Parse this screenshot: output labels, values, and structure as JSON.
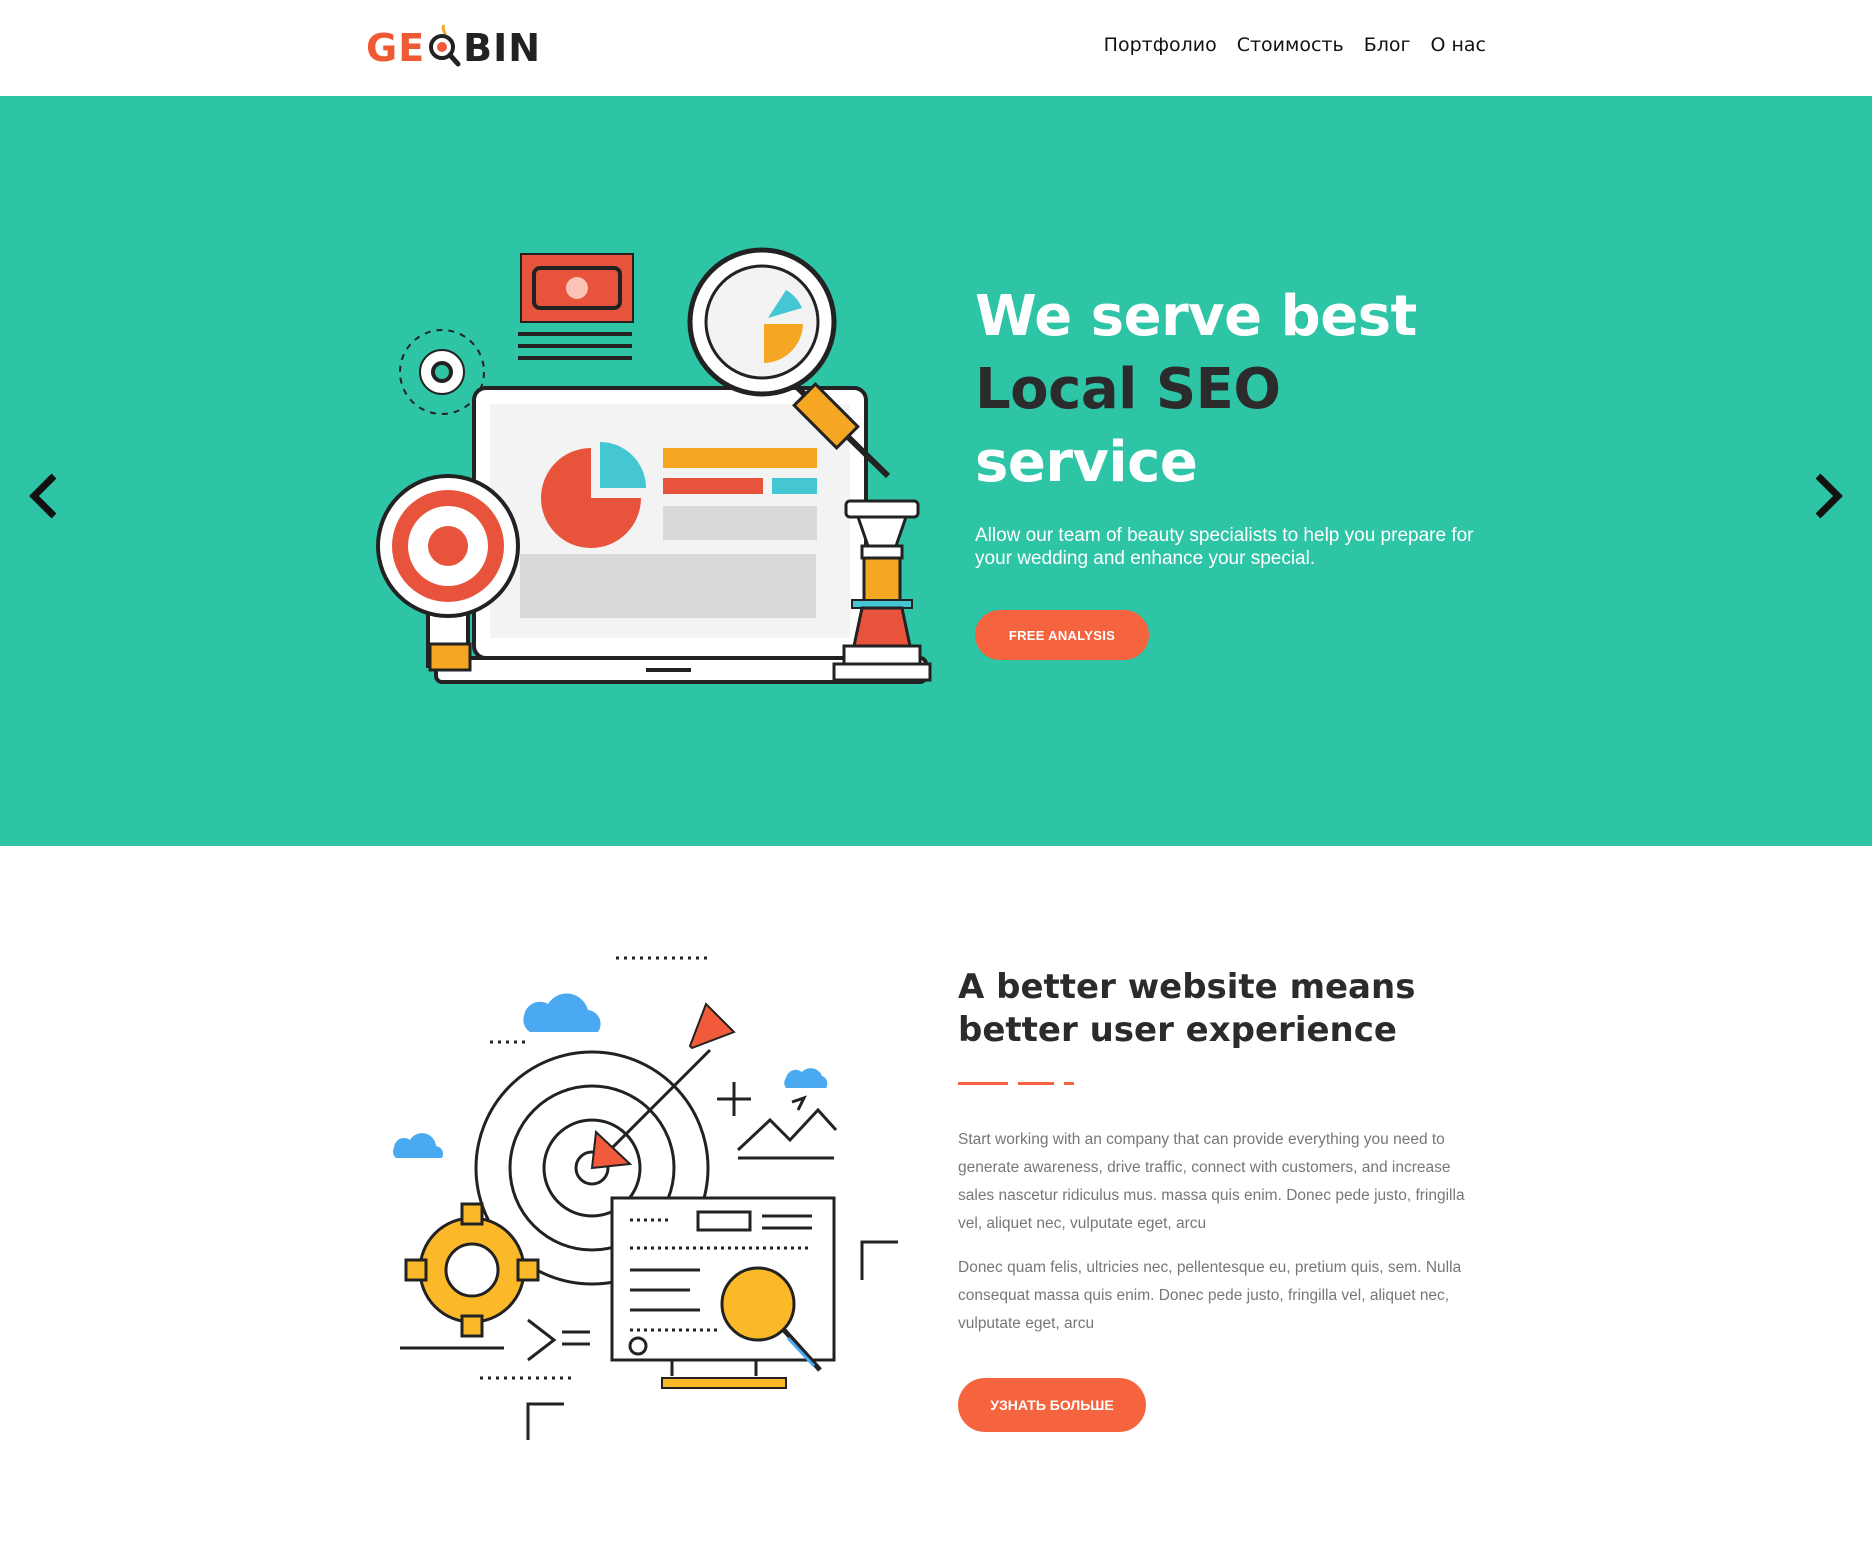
{
  "header": {
    "logo": {
      "part1": "GE",
      "part2": "BIN"
    },
    "nav": [
      {
        "label": "Портфолио"
      },
      {
        "label": "Стоимость"
      },
      {
        "label": "Блог"
      },
      {
        "label": "О нас"
      }
    ]
  },
  "hero": {
    "title_line1": "We serve best",
    "title_line2": "Local SEO",
    "title_line3": "service",
    "subtitle": "Allow our team of beauty specialists to help you prepare for your wedding and enhance your special.",
    "button_label": "FREE ANALYSIS",
    "prev_icon": "chevron-left-icon",
    "next_icon": "chevron-right-icon"
  },
  "feature": {
    "title": "A better website means better user experience",
    "paragraph1": "Start working with an company that can provide everything you need to generate awareness, drive traffic, connect with customers, and increase sales nascetur ridiculus mus. massa quis enim. Donec pede justo, fringilla vel, aliquet nec, vulputate eget, arcu",
    "paragraph2": "Donec quam felis, ultricies nec, pellentesque eu, pretium quis, sem. Nulla consequat massa quis enim. Donec pede justo, fringilla vel, aliquet nec, vulputate eget, arcu",
    "button_label": "УЗНАТЬ БОЛЬШЕ"
  },
  "colors": {
    "accent": "#f5643f",
    "hero_bg": "#2ec4a6",
    "text_dark": "#2b2b2b",
    "text_muted": "#777777"
  }
}
